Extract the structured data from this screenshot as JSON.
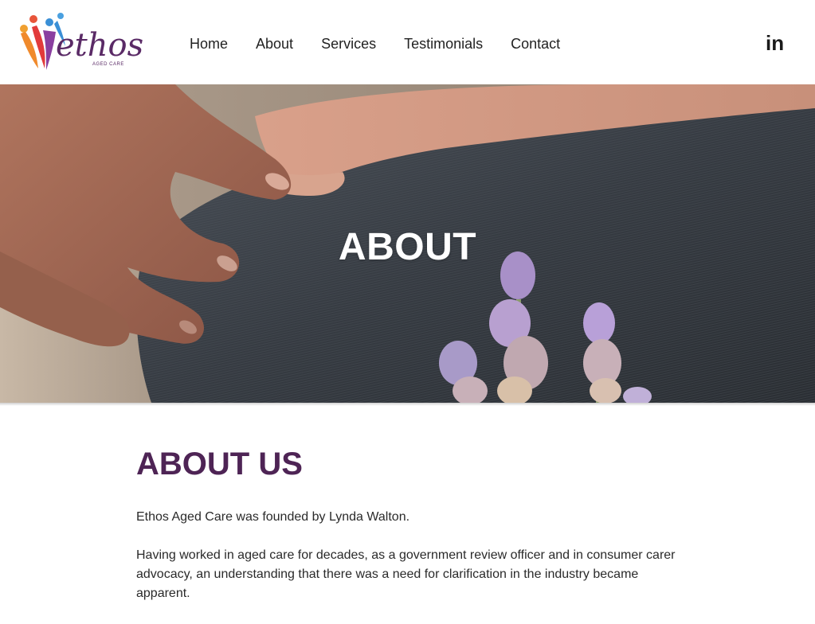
{
  "brand": {
    "logo_word": "ethos",
    "logo_tagline": "AGED CARE",
    "colors": {
      "primary": "#4e2455",
      "accent_orange": "#f08a2c",
      "accent_red": "#e23b3b",
      "accent_blue": "#3a8fd6"
    }
  },
  "nav": {
    "items": [
      {
        "label": "Home"
      },
      {
        "label": "About"
      },
      {
        "label": "Services"
      },
      {
        "label": "Testimonials"
      },
      {
        "label": "Contact"
      }
    ],
    "social_icon": "linkedin-icon",
    "social_label": "in"
  },
  "hero": {
    "title": "ABOUT"
  },
  "main": {
    "heading": "ABOUT US",
    "paragraphs": [
      "Ethos Aged Care was founded by Lynda Walton.",
      "Having worked in aged care for decades, as a government review officer and in consumer carer advocacy, an understanding that there was a need for clarification in the industry became apparent."
    ]
  }
}
